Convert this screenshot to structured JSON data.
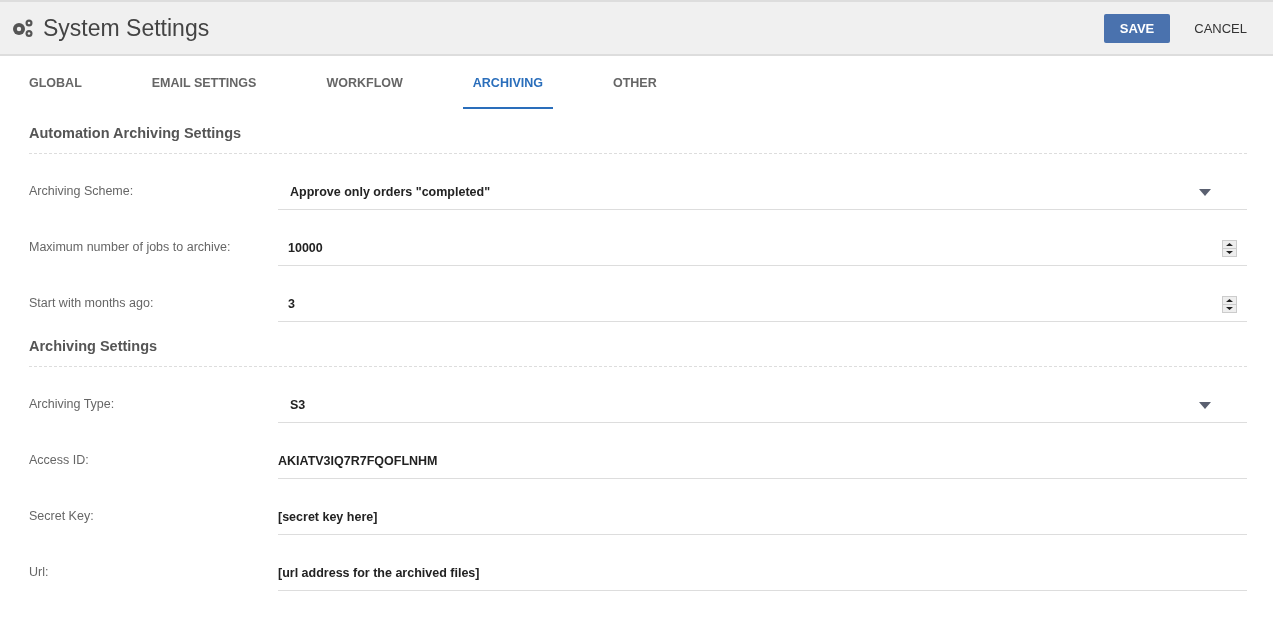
{
  "header": {
    "title": "System Settings",
    "buttons": [
      {
        "label": "SAVE",
        "kind": "primary"
      },
      {
        "label": "CANCEL",
        "kind": "plain"
      }
    ]
  },
  "tabs": [
    {
      "label": "GLOBAL",
      "selected": false
    },
    {
      "label": "EMAIL SETTINGS",
      "selected": false
    },
    {
      "label": "WORKFLOW",
      "selected": false
    },
    {
      "label": "ARCHIVING",
      "selected": true
    },
    {
      "label": "OTHER",
      "selected": false
    }
  ],
  "sections": [
    {
      "title": "Automation Archiving Settings",
      "fields": [
        {
          "label": "Archiving Scheme:",
          "kind": "select",
          "value": "Approve only orders \"completed\""
        },
        {
          "label": "Maximum number of jobs to archive:",
          "kind": "number",
          "value": "10000"
        },
        {
          "label": "Start with months ago:",
          "kind": "number",
          "value": "3"
        }
      ]
    },
    {
      "title": "Archiving Settings",
      "fields": [
        {
          "label": "Archiving Type:",
          "kind": "select",
          "value": "S3"
        },
        {
          "label": "Access ID:",
          "kind": "text",
          "value": "AKIATV3IQ7R7FQOFLNHM"
        },
        {
          "label": "Secret Key:",
          "kind": "text",
          "value": "[secret key here]"
        },
        {
          "label": "Url:",
          "kind": "text",
          "value": "[url address for the archived files]"
        }
      ]
    }
  ]
}
